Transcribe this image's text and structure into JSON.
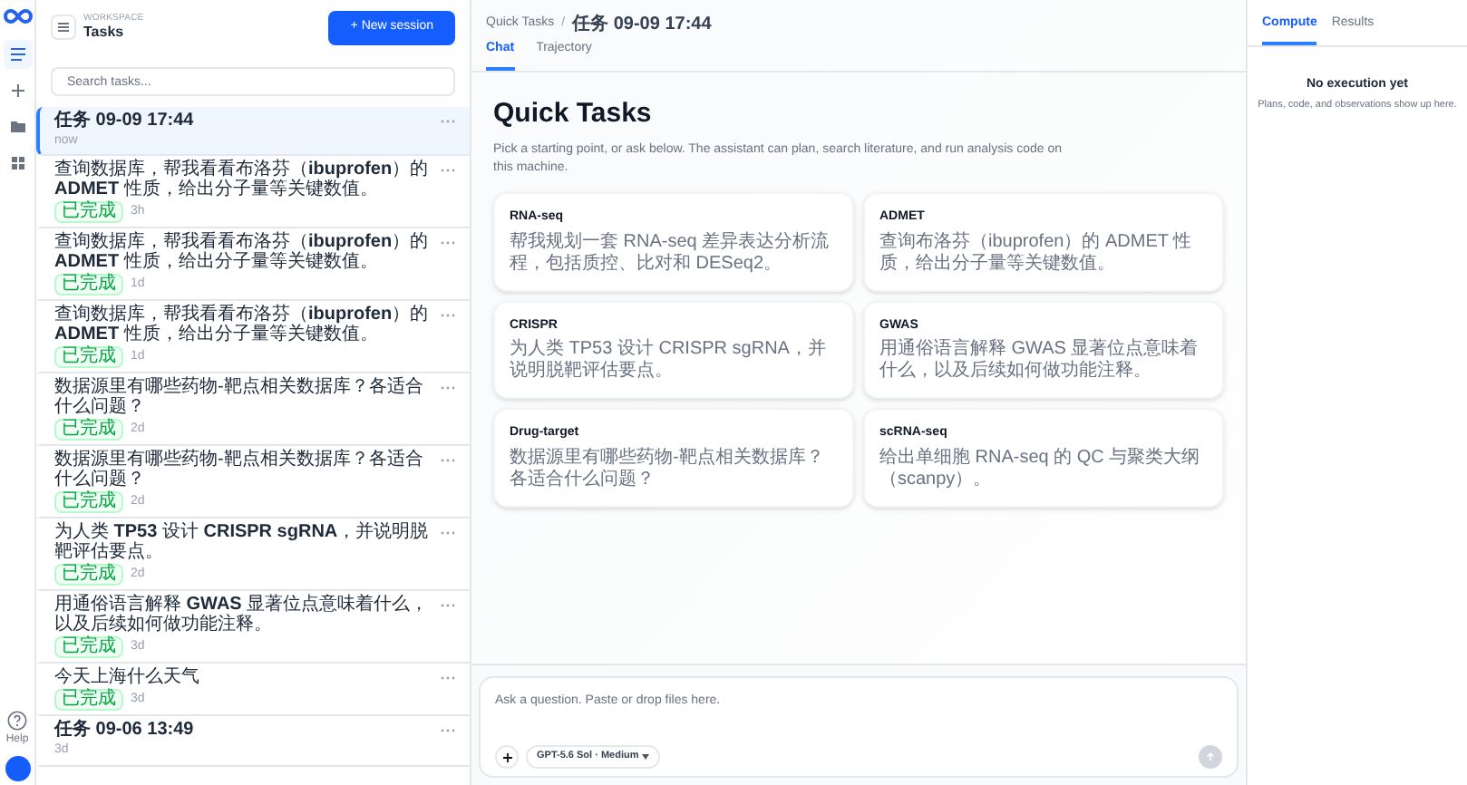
{
  "rail": {
    "items": [
      {
        "kind": "list",
        "selected": true
      },
      {
        "kind": "plus",
        "selected": false
      },
      {
        "kind": "folder",
        "selected": false
      },
      {
        "kind": "grid",
        "selected": false
      }
    ],
    "help_label": "Help"
  },
  "task_panel": {
    "workspace_label": "WORKSPACE",
    "title": "Tasks",
    "new_button": "+ New session",
    "search": {
      "placeholder": "Search tasks..."
    },
    "tasks": [
      {
        "kind": "session",
        "title": "任务 09-09 17:44",
        "time": "now",
        "selected": true
      },
      {
        "kind": "query",
        "title": "查询数据库，帮我看看布洛芬（**ibuprofen**）的 **ADMET** 性质，给出分子量等关键数值。",
        "status": "已完成",
        "time": "3h",
        "selected": false
      },
      {
        "kind": "query",
        "title": "查询数据库，帮我看看布洛芬（**ibuprofen**）的 **ADMET** 性质，给出分子量等关键数值。",
        "status": "已完成",
        "time": "1d",
        "selected": false
      },
      {
        "kind": "query",
        "title": "查询数据库，帮我看看布洛芬（**ibuprofen**）的 **ADMET** 性质，给出分子量等关键数值。",
        "status": "已完成",
        "time": "1d",
        "selected": false
      },
      {
        "kind": "query",
        "title": "数据源里有哪些药物-靶点相关数据库？各适合什么问题？",
        "status": "已完成",
        "time": "2d",
        "selected": false
      },
      {
        "kind": "query",
        "title": "数据源里有哪些药物-靶点相关数据库？各适合什么问题？",
        "status": "已完成",
        "time": "2d",
        "selected": false
      },
      {
        "kind": "query",
        "title": "为人类 **TP53** 设计 **CRISPR sgRNA**，并说明脱靶评估要点。",
        "status": "已完成",
        "time": "2d",
        "selected": false
      },
      {
        "kind": "query",
        "title": "用通俗语言解释 **GWAS** 显著位点意味着什么，以及后续如何做功能注释。",
        "status": "已完成",
        "time": "3d",
        "selected": false
      },
      {
        "kind": "query",
        "title": "今天上海什么天气",
        "status": "已完成",
        "time": "3d",
        "selected": false
      },
      {
        "kind": "session",
        "title": "任务 09-06 13:49",
        "time": "3d",
        "selected": false
      }
    ]
  },
  "main": {
    "breadcrumb": [
      "Quick Tasks",
      "任务 09-09 17:44"
    ],
    "breadcrumb_separator": "/",
    "tabs": [
      {
        "label": "Chat",
        "selected": true
      },
      {
        "label": "Trajectory",
        "selected": false
      }
    ],
    "heading": "Quick Tasks",
    "intro": "Pick a starting point, or ask below. The assistant can plan, search literature, and run analysis code on this machine.",
    "cards": [
      {
        "title": "RNA-seq",
        "description": "帮我规划一套 RNA-seq 差异表达分析流程，包括质控、比对和 DESeq2。"
      },
      {
        "title": "ADMET",
        "description": "查询布洛芬（ibuprofen）的 ADMET 性质，给出分子量等关键数值。"
      },
      {
        "title": "CRISPR",
        "description": "为人类 TP53 设计 CRISPR sgRNA，并说明脱靶评估要点。"
      },
      {
        "title": "GWAS",
        "description": "用通俗语言解释 GWAS 显著位点意味着什么，以及后续如何做功能注释。"
      },
      {
        "title": "Drug-target",
        "description": "数据源里有哪些药物-靶点相关数据库？各适合什么问题？"
      },
      {
        "title": "scRNA-seq",
        "description": "给出单细胞 RNA-seq 的 QC 与聚类大纲（scanpy）。"
      }
    ],
    "composer": {
      "placeholder": "Ask a question. Paste or drop files here.",
      "model": "GPT-5.6 Sol · Medium"
    }
  },
  "right_panel": {
    "tabs": [
      {
        "label": "Compute",
        "selected": true
      },
      {
        "label": "Results",
        "selected": false
      }
    ],
    "empty_title": "No execution yet",
    "empty_text": "Plans, code, and observations show up here."
  }
}
